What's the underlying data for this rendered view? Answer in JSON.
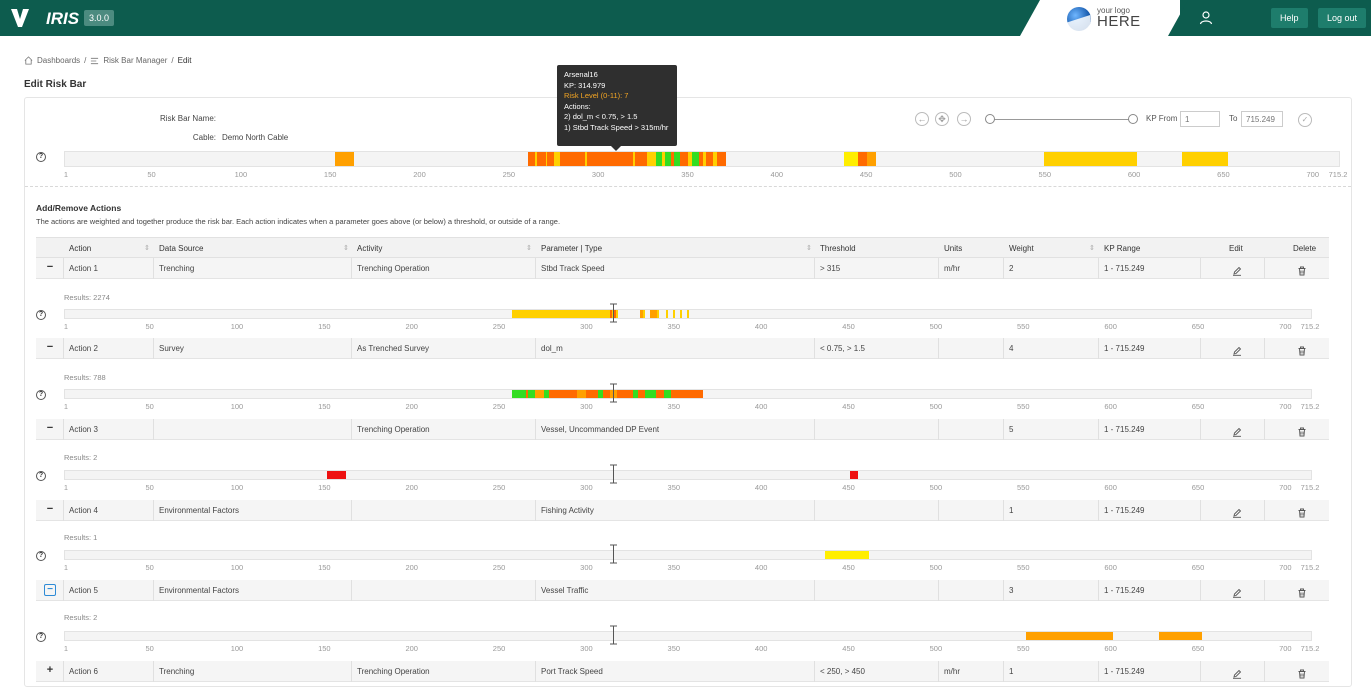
{
  "nav": {
    "app_name": "IRIS",
    "version": "3.0.0",
    "logo_line1": "your logo",
    "logo_line2": "HERE",
    "help_label": "Help",
    "logout_label": "Log out",
    "bg_color": "#0d5c4e"
  },
  "breadcrumb": {
    "items": [
      "Dashboards",
      "Risk Bar Manager",
      "Edit"
    ]
  },
  "page_title": "Edit Risk Bar",
  "risk_bar": {
    "name_label": "Risk Bar Name:",
    "name_value": "",
    "cable_label": "Cable:",
    "cable_value": "Demo North Cable",
    "kp_from_label": "KP From",
    "kp_from_placeholder": "1",
    "kp_to_label": "To",
    "kp_to_placeholder": "715.249",
    "axis_ticks": [
      "1",
      "50",
      "100",
      "150",
      "200",
      "250",
      "300",
      "350",
      "400",
      "450",
      "500",
      "550",
      "600",
      "650",
      "700",
      "715.2"
    ]
  },
  "tooltip": {
    "title": "Arsenal16",
    "kp": "KP: 314.979",
    "risk_level": "Risk Level (0-11): 7",
    "actions_label": "Actions:",
    "action_line1": "2) dol_m < 0.75, > 1.5",
    "action_line2": "1) Stbd Track Speed > 315m/hr"
  },
  "actions_section": {
    "title": "Add/Remove Actions",
    "description": "The actions are weighted and together produce the risk bar. Each action indicates when a parameter goes above (or below) a threshold, or outside of a range."
  },
  "table": {
    "headers": [
      "Action",
      "Data Source",
      "Activity",
      "Parameter | Type",
      "Threshold",
      "Units",
      "Weight",
      "KP Range",
      "Edit",
      "Delete"
    ],
    "rows": [
      {
        "toggle": "−",
        "action": "Action 1",
        "source": "Trenching",
        "activity": "Trenching Operation",
        "parameter": "Stbd Track Speed",
        "threshold": "> 315",
        "units": "m/hr",
        "weight": "2",
        "kp_range": "1 - 715.249",
        "results": "Results: 2274"
      },
      {
        "toggle": "−",
        "action": "Action 2",
        "source": "Survey",
        "activity": "As Trenched Survey",
        "parameter": "dol_m",
        "threshold": "< 0.75, > 1.5",
        "units": "",
        "weight": "4",
        "kp_range": "1 - 715.249",
        "results": "Results: 788"
      },
      {
        "toggle": "−",
        "action": "Action 3",
        "source": "",
        "activity": "Trenching Operation",
        "parameter": "Vessel, Uncommanded DP Event",
        "threshold": "",
        "units": "",
        "weight": "5",
        "kp_range": "1 - 715.249",
        "results": "Results: 2"
      },
      {
        "toggle": "−",
        "action": "Action 4",
        "source": "Environmental Factors",
        "activity": "",
        "parameter": "Fishing Activity",
        "threshold": "",
        "units": "",
        "weight": "1",
        "kp_range": "1 - 715.249",
        "results": "Results: 1"
      },
      {
        "toggle": "−",
        "action": "Action 5",
        "source": "Environmental Factors",
        "activity": "",
        "parameter": "Vessel Traffic",
        "threshold": "",
        "units": "",
        "weight": "3",
        "kp_range": "1 - 715.249",
        "results": "Results: 2"
      },
      {
        "toggle": "+",
        "action": "Action 6",
        "source": "Trenching",
        "activity": "Trenching Operation",
        "parameter": "Port Track Speed",
        "threshold": "< 250, > 450",
        "units": "m/hr",
        "weight": "1",
        "kp_range": "1 - 715.249",
        "results": ""
      }
    ]
  },
  "colors": {
    "orange": "#ff6a00",
    "amber": "#ffa000",
    "yellow": "#ffd000",
    "bright_yellow": "#ffee00",
    "green": "#33dd22",
    "red": "#ee1111"
  },
  "cursor_kp": 315
}
